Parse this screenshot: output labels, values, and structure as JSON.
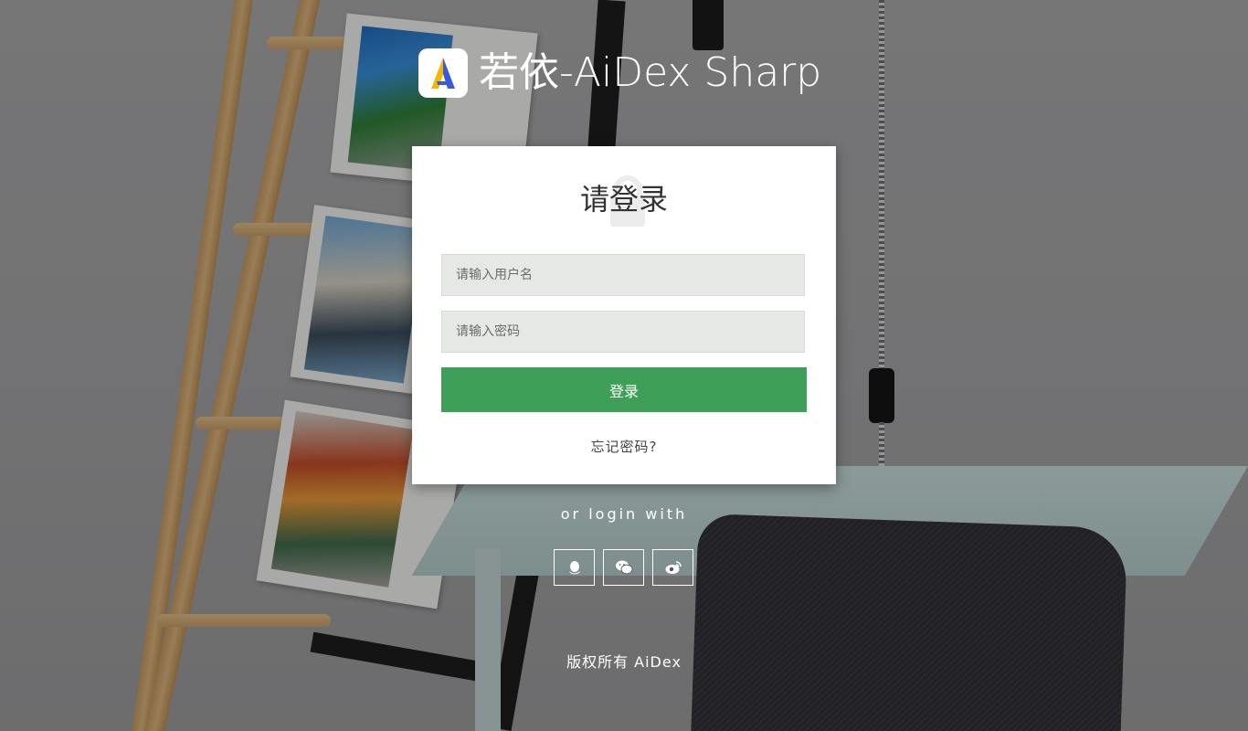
{
  "brand": {
    "title": "若依-AiDex Sharp",
    "logo_icon": "aidex-logo-icon"
  },
  "login": {
    "title": "请登录",
    "username_placeholder": "请输入用户名",
    "password_placeholder": "请输入密码",
    "submit_label": "登录",
    "forgot_label": "忘记密码?"
  },
  "social": {
    "label": "or login with",
    "providers": [
      {
        "name": "qq",
        "icon": "qq-icon"
      },
      {
        "name": "wechat",
        "icon": "wechat-icon"
      },
      {
        "name": "weibo",
        "icon": "weibo-icon"
      }
    ]
  },
  "footer": {
    "copyright": "版权所有 AiDex"
  },
  "colors": {
    "primary_button": "#3d9f58",
    "input_bg": "#e5e8e5",
    "panel_bg": "#ffffff",
    "text_light": "#ffffff"
  }
}
